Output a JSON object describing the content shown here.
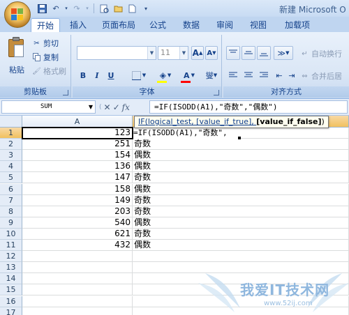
{
  "window": {
    "title": "新建 Microsoft O"
  },
  "quick_access": {
    "icons": [
      "save-icon",
      "undo-icon",
      "redo-icon",
      "print-preview-icon",
      "open-icon",
      "new-icon",
      "customize-icon"
    ]
  },
  "tabs": [
    {
      "label": "开始",
      "active": true
    },
    {
      "label": "插入",
      "active": false
    },
    {
      "label": "页面布局",
      "active": false
    },
    {
      "label": "公式",
      "active": false
    },
    {
      "label": "数据",
      "active": false
    },
    {
      "label": "审阅",
      "active": false
    },
    {
      "label": "视图",
      "active": false
    },
    {
      "label": "加载项",
      "active": false
    }
  ],
  "ribbon": {
    "clipboard": {
      "group_label": "剪贴板",
      "paste_label": "粘贴",
      "cut_label": "剪切",
      "copy_label": "复制",
      "format_painter_label": "格式刷"
    },
    "font": {
      "group_label": "字体",
      "font_name": "",
      "font_size": "11",
      "grow_label": "A",
      "shrink_label": "A",
      "bold_label": "B",
      "italic_label": "I",
      "underline_label": "U",
      "font_color_label": "A",
      "phonetic_label": "燮"
    },
    "alignment": {
      "group_label": "对齐方式",
      "wrap_text_label": "自动换行",
      "merge_center_label": "合并后居"
    }
  },
  "formula_bar": {
    "name_box": "SUM",
    "cancel_icon": "✕",
    "enter_icon": "✓",
    "fx_label": "fx",
    "formula": "=IF(ISODD(A1),\"奇数\",\"偶数\")"
  },
  "sheet": {
    "columns": [
      "A",
      ""
    ],
    "rows": [
      "1",
      "2",
      "3",
      "4",
      "5",
      "6",
      "7",
      "8",
      "9",
      "10",
      "11",
      "12",
      "13",
      "14",
      "15",
      "16",
      "17"
    ],
    "col_a_values": [
      "123",
      "251",
      "154",
      "136",
      "147",
      "158",
      "149",
      "203",
      "540",
      "621",
      "432"
    ],
    "col_b_values": [
      "",
      "奇数",
      "偶数",
      "偶数",
      "奇数",
      "偶数",
      "奇数",
      "奇数",
      "偶数",
      "奇数",
      "偶数"
    ],
    "editing_text": "=IF(ISODD(A1),\"奇数\",",
    "tooltip": {
      "prefix": "IF(logical_test, [value_if_true], ",
      "current": "[value_if_false]",
      "suffix": ")"
    }
  },
  "watermark": {
    "text": "我爱IT技术网",
    "url": "www.52ij.com"
  },
  "colors": {
    "ribbon_bg": "#dbe7f6",
    "header_selected": "#f1c15f",
    "tab_text": "#15428b"
  }
}
